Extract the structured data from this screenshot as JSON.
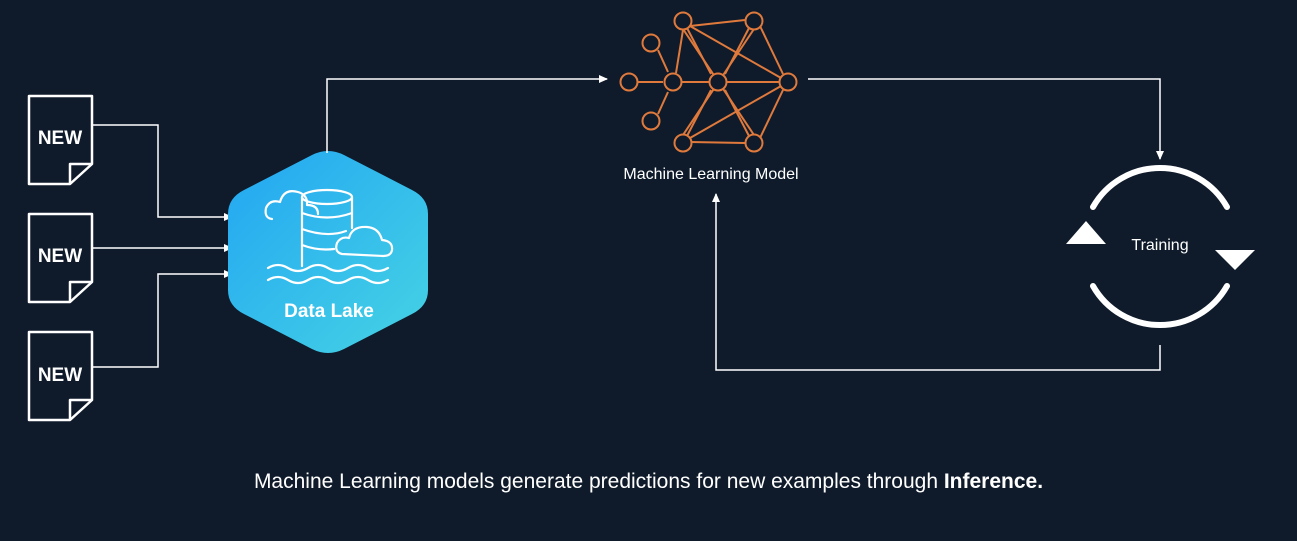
{
  "documents": [
    {
      "label": "NEW"
    },
    {
      "label": "NEW"
    },
    {
      "label": "NEW"
    }
  ],
  "data_lake": {
    "label": "Data Lake"
  },
  "ml_model": {
    "label": "Machine Learning Model"
  },
  "training": {
    "label": "Training"
  },
  "caption": {
    "text": "Machine Learning models generate predictions for new examples through ",
    "emphasis": "Inference."
  },
  "colors": {
    "background": "#0f1b2b",
    "lake_gradient_top": "#2fb3f0",
    "lake_gradient_bottom": "#3fd0e6",
    "network": "#e07a3c",
    "lines": "#ffffff"
  }
}
